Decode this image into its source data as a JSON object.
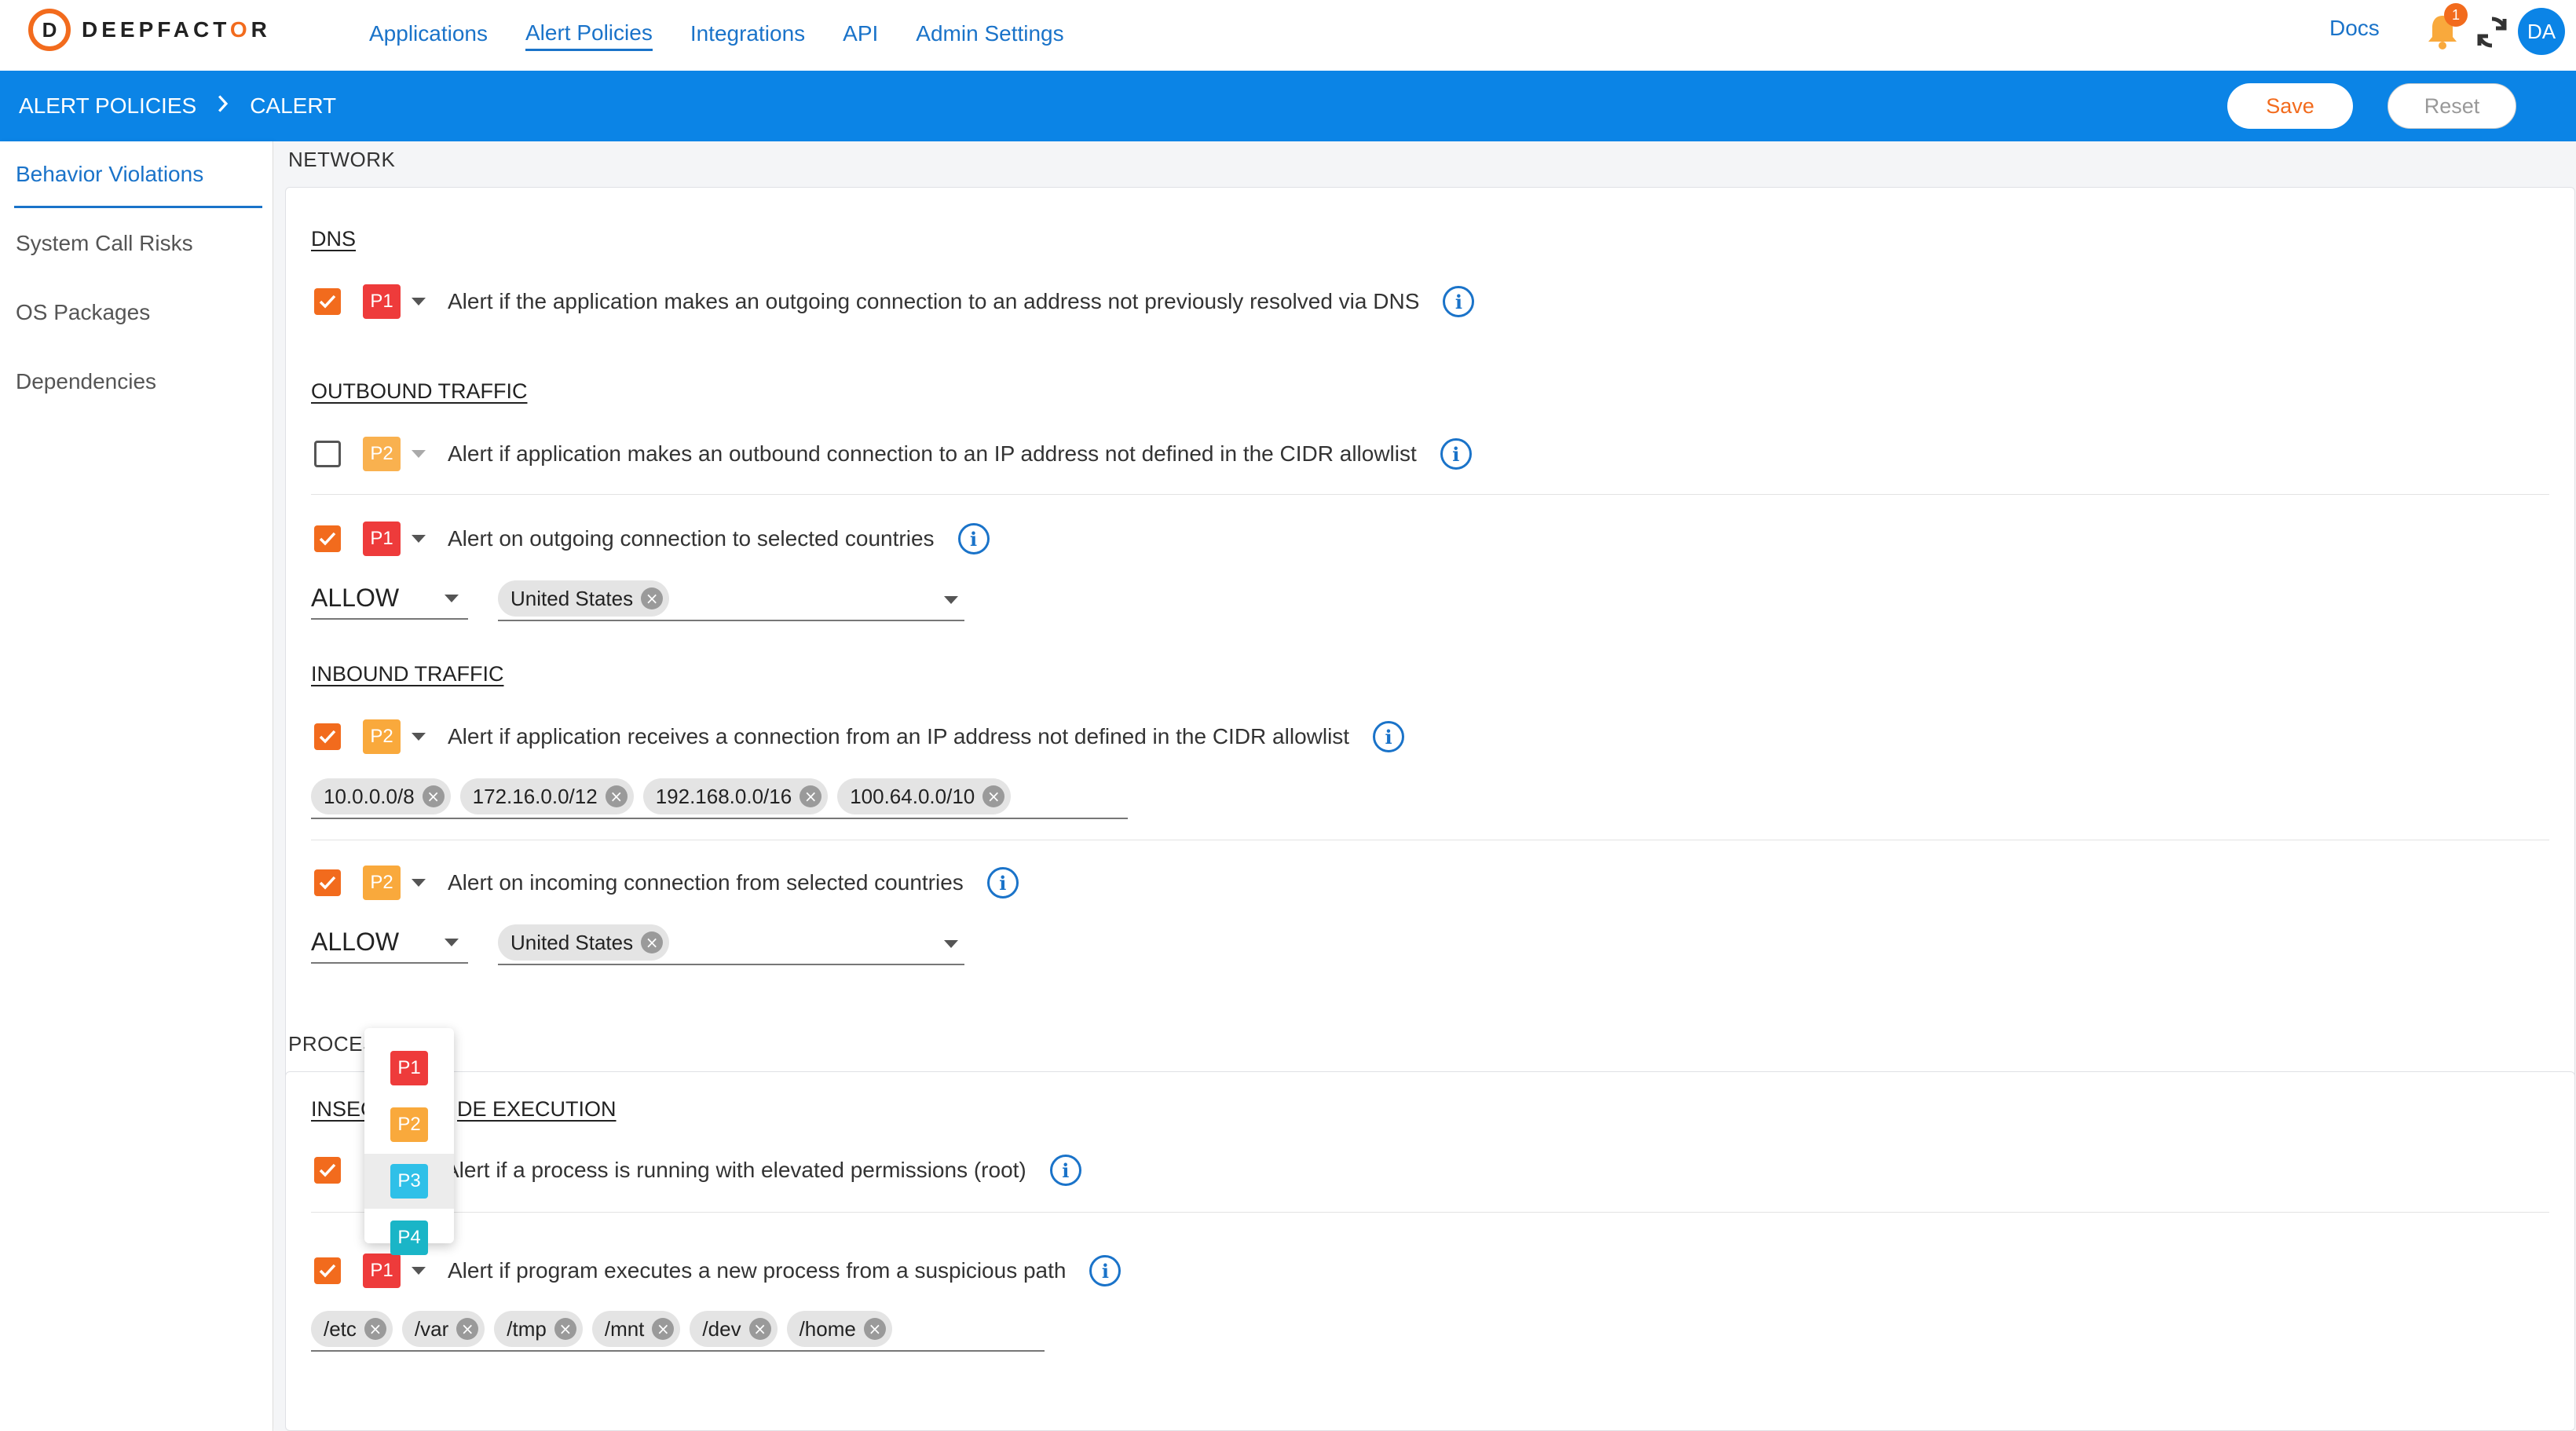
{
  "brand": {
    "logo_letter": "D",
    "name_pre": "DEEPFACT",
    "name_o": "O",
    "name_post": "R",
    "accent": "#f26b1d"
  },
  "nav": {
    "links": [
      "Applications",
      "Alert Policies",
      "Integrations",
      "API",
      "Admin Settings"
    ],
    "active": "Alert Policies",
    "docs": "Docs",
    "notification_count": "1",
    "avatar": "DA"
  },
  "header": {
    "crumb_root": "ALERT POLICIES",
    "crumb_sep": ">",
    "crumb_current": "CALERT",
    "save_label": "Save",
    "reset_label": "Reset",
    "bar_color": "#0b84e6"
  },
  "sidebar": {
    "items": [
      "Behavior Violations",
      "System Call Risks",
      "OS Packages",
      "Dependencies"
    ],
    "active_index": 0
  },
  "network": {
    "label": "NETWORK",
    "dns": {
      "title": "DNS",
      "rule": {
        "checked": true,
        "priority": "P1",
        "text": "Alert if the application makes an outgoing connection to an address not previously resolved via DNS"
      }
    },
    "outbound": {
      "title": "OUTBOUND TRAFFIC",
      "rule1": {
        "checked": false,
        "priority": "P2",
        "text": "Alert if application makes an outbound connection to an IP address not defined in the CIDR allowlist"
      },
      "rule2": {
        "checked": true,
        "priority": "P1",
        "text": "Alert on outgoing connection to selected countries",
        "mode": "ALLOW",
        "countries": [
          "United States"
        ]
      }
    },
    "inbound": {
      "title": "INBOUND TRAFFIC",
      "rule1": {
        "checked": true,
        "priority": "P2",
        "text": "Alert if application receives a connection from an IP address not defined in the CIDR allowlist",
        "cidrs": [
          "10.0.0.0/8",
          "172.16.0.0/12",
          "192.168.0.0/16",
          "100.64.0.0/10"
        ]
      },
      "rule2": {
        "checked": true,
        "priority": "P2",
        "text": "Alert on incoming connection from selected countries",
        "mode": "ALLOW",
        "countries": [
          "United States"
        ]
      }
    }
  },
  "process": {
    "label_visible": "PROCES",
    "group_title_left": "INSEC",
    "group_title_right": "DE EXECUTION",
    "rule1": {
      "checked": true,
      "text": "Alert if a process is running with elevated permissions (root)"
    },
    "rule2": {
      "checked": true,
      "priority": "P1",
      "text": "Alert if program executes a new process from a suspicious path",
      "paths": [
        "/etc",
        "/var",
        "/tmp",
        "/mnt",
        "/dev",
        "/home"
      ]
    }
  },
  "priority_menu": {
    "options": [
      "P1",
      "P2",
      "P3",
      "P4"
    ],
    "hovered": "P3",
    "colors": {
      "P1": "#ee3b3b",
      "P2": "#f9a93c",
      "P3": "#2fc0e8",
      "P4": "#1ab5c7"
    }
  },
  "icons": {
    "info": "info-icon",
    "close": "close-icon",
    "check": "check-icon",
    "bell": "bell-icon",
    "sync": "sync-icon",
    "chevron": "chevron-right-icon"
  },
  "glyphs": {
    "info": "i",
    "remove": "×"
  }
}
